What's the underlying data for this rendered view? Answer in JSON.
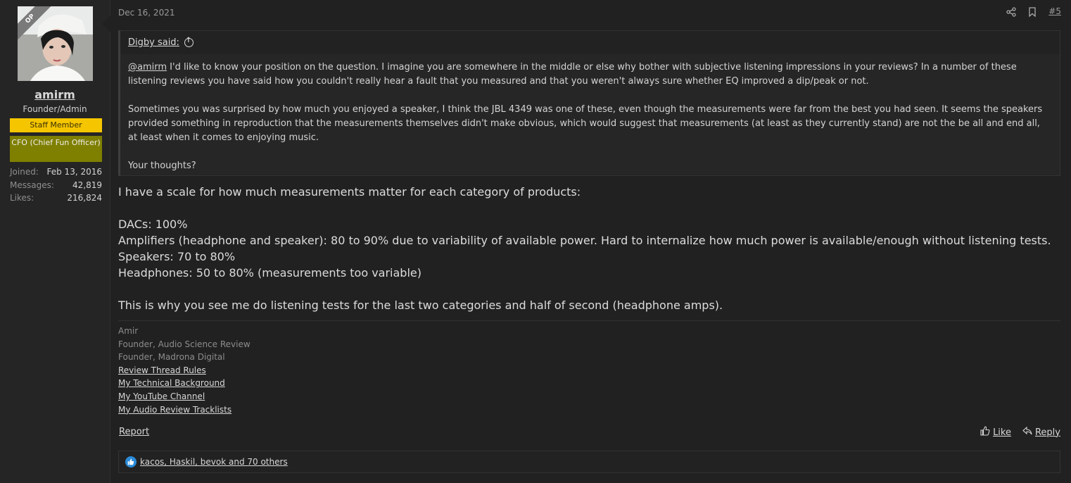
{
  "user": {
    "op_badge": "OP",
    "username": "amirm",
    "title": "Founder/Admin",
    "banner_staff": "Staff Member",
    "banner_cfo": "CFO (Chief Fun Officer)",
    "stats": [
      {
        "label": "Joined:",
        "value": "Feb 13, 2016"
      },
      {
        "label": "Messages:",
        "value": "42,819"
      },
      {
        "label": "Likes:",
        "value": "216,824"
      }
    ]
  },
  "post": {
    "date": "Dec 16, 2021",
    "number": "#5",
    "share_icon": "share-icon",
    "bookmark_icon": "bookmark-icon"
  },
  "quote": {
    "author": "Digby said:",
    "mention": "@amirm",
    "p1_rest": " I'd like to know your position on the question. I imagine you are somewhere in the middle or else why bother with subjective listening impressions in your reviews? In a number of these listening reviews you have said how you couldn't really hear a fault that you measured and that you weren't always sure whether EQ improved a dip/peak or not.",
    "p2": "Sometimes you was surprised by how much you enjoyed a speaker, I think the JBL 4349 was one of these, even though the measurements were far from the best you had seen. It seems the speakers provided something in reproduction that the measurements themselves didn't make obvious, which would suggest that measurements (at least as they currently stand) are not the be all and end all, at least when it comes to enjoying music.",
    "p3": "Your thoughts?"
  },
  "message": {
    "lines": [
      "I have a scale for how much measurements matter for each category of products:",
      "",
      "DACs: 100%",
      "Amplifiers (headphone and speaker): 80 to 90% due to variability of available power. Hard to internalize how much power is available/enough without listening tests.",
      "Speakers: 70 to 80%",
      "Headphones: 50 to 80% (measurements too variable)",
      "",
      "This is why you see me do listening tests for the last two categories and half of second (headphone amps)."
    ]
  },
  "signature": {
    "lines": [
      "Amir",
      "Founder, Audio Science Review",
      "Founder, Madrona Digital"
    ],
    "links": [
      "Review Thread Rules",
      "My Technical Background",
      "My YouTube Channel",
      "My Audio Review Tracklists"
    ]
  },
  "actions": {
    "report": "Report",
    "like": "Like",
    "reply": "Reply"
  },
  "reactions": {
    "text": "kacos, Haskil, bevok and 70 others"
  }
}
